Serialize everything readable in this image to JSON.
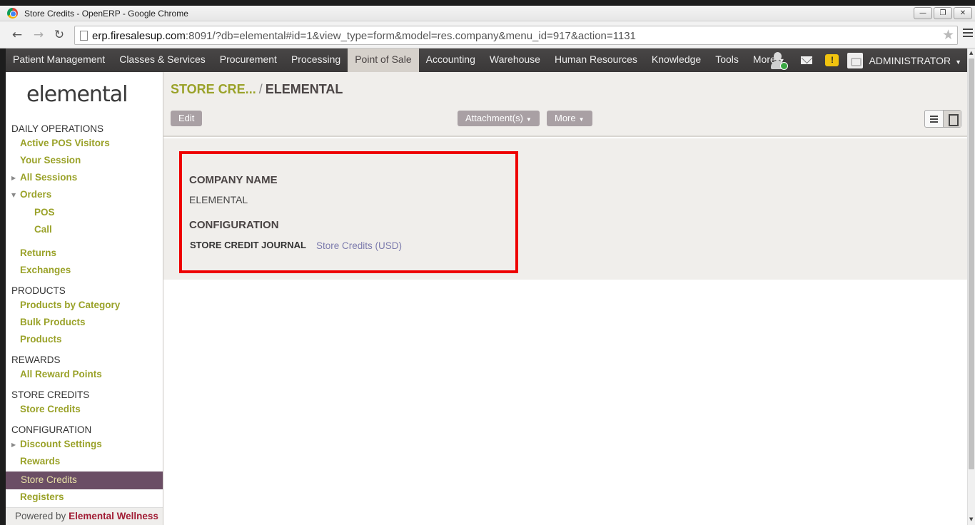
{
  "window": {
    "title": "Store Credits - OpenERP - Google Chrome"
  },
  "browser": {
    "url_host": "erp.firesalesup.com",
    "url_rest": ":8091/?db=elemental#id=1&view_type=form&model=res.company&menu_id=917&action=1131"
  },
  "topmenu": {
    "items": [
      "Patient Management",
      "Classes & Services",
      "Procurement",
      "Processing",
      "Point of Sale",
      "Accounting",
      "Warehouse",
      "Human Resources",
      "Knowledge",
      "Tools",
      "More"
    ],
    "active": "Point of Sale",
    "user": "ADMINISTRATOR"
  },
  "sidebar": {
    "logo": "elemental",
    "sections": [
      {
        "title": "DAILY OPERATIONS",
        "items": [
          "Active POS Visitors",
          "Your Session",
          "All Sessions",
          "Orders",
          "POS",
          "Call",
          "Returns",
          "Exchanges"
        ]
      },
      {
        "title": "PRODUCTS",
        "items": [
          "Products by Category",
          "Bulk Products",
          "Products"
        ]
      },
      {
        "title": "REWARDS",
        "items": [
          "All Reward Points"
        ]
      },
      {
        "title": "STORE CREDITS",
        "items": [
          "Store Credits"
        ]
      },
      {
        "title": "CONFIGURATION",
        "items": [
          "Discount Settings",
          "Rewards",
          "Store Credits",
          "Registers"
        ]
      }
    ],
    "powered_prefix": "Powered by",
    "powered_brand": "Elemental Wellness"
  },
  "main": {
    "breadcrumb_link": "STORE CRE...",
    "breadcrumb_sep": "/",
    "breadcrumb_current": "ELEMENTAL",
    "edit_label": "Edit",
    "attachments_label": "Attachment(s)",
    "more_label": "More",
    "form": {
      "company_name_label": "COMPANY NAME",
      "company_name_value": "ELEMENTAL",
      "configuration_label": "CONFIGURATION",
      "journal_label": "STORE CREDIT JOURNAL",
      "journal_value": "Store Credits (USD)"
    }
  },
  "colors": {
    "highlight_box": "#ee0000",
    "menu_link": "#9aa229",
    "selected_bg": "#6b4e65"
  }
}
